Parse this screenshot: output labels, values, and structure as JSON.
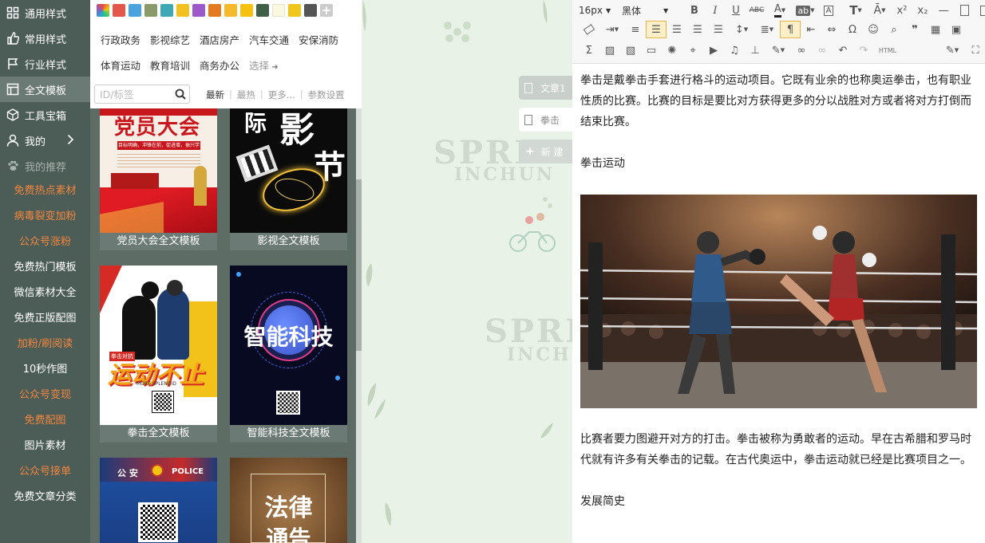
{
  "sidebar": {
    "items": [
      {
        "label": "通用样式",
        "icon": "grid-icon"
      },
      {
        "label": "常用样式",
        "icon": "thumbs-up-icon"
      },
      {
        "label": "行业样式",
        "icon": "flag-icon"
      },
      {
        "label": "全文模板",
        "icon": "template-icon"
      },
      {
        "label": "工具宝箱",
        "icon": "box-icon"
      },
      {
        "label": "我的",
        "icon": "user-icon"
      },
      {
        "label": "我的推荐",
        "icon": "paw-icon"
      }
    ],
    "promos": [
      {
        "label": "免费热点素材",
        "color": "orange"
      },
      {
        "label": "病毒裂变加粉",
        "color": "orange"
      },
      {
        "label": "公众号涨粉",
        "color": "orange"
      },
      {
        "label": "免费热门模板",
        "color": "white"
      },
      {
        "label": "微信素材大全",
        "color": "white"
      },
      {
        "label": "免费正版配图",
        "color": "white"
      },
      {
        "label": "加粉/刷阅读",
        "color": "orange"
      },
      {
        "label": "10秒作图",
        "color": "white"
      },
      {
        "label": "公众号变现",
        "color": "orange"
      },
      {
        "label": "免费配图",
        "color": "orange"
      },
      {
        "label": "图片素材",
        "color": "white"
      },
      {
        "label": "公众号接单",
        "color": "orange"
      },
      {
        "label": "免费文章分类",
        "color": "white"
      }
    ]
  },
  "filter": {
    "swatch_colors": [
      "#e4564a",
      "#4aa3df",
      "#8a9a6a",
      "#3fa8b4",
      "#f2c01f",
      "#9b59c9",
      "#e37a1f",
      "#f5b92b",
      "#f6c20f",
      "#3f5f47",
      "#fbf8e2",
      "#f0c61a",
      "#555555"
    ],
    "categories_row1": [
      "行政政务",
      "影视综艺",
      "酒店房产",
      "汽车交通",
      "安保消防"
    ],
    "categories_row2": [
      "体育运动",
      "教育培训",
      "商务办公"
    ],
    "select_label": "选择",
    "search_placeholder": "ID/标签",
    "sort_tabs": [
      "最新",
      "最热",
      "更多...",
      "参数设置"
    ]
  },
  "templates": [
    {
      "caption": "党员大会全文模板",
      "poster_title": "党员大会",
      "poster_sub": "目标明确，冲锋在前，促进增，振兴学"
    },
    {
      "caption": "影视全文模板",
      "poster_title": "影",
      "poster_title2": "节",
      "poster_side": "际"
    },
    {
      "caption": "拳击全文模板",
      "poster_title": "运动不止",
      "poster_tag": "拳击对抗",
      "poster_sub": "MORE SPLENDID"
    },
    {
      "caption": "智能科技全文模板",
      "poster_title": "智能科技"
    },
    {
      "caption": "",
      "poster_title": "公 安",
      "poster_sub": "POLICE"
    },
    {
      "caption": "",
      "poster_title": "法律",
      "poster_title2": "通告"
    }
  ],
  "middle": {
    "watermark1": "SPRING",
    "watermark1_sub": "INCHUN",
    "watermark2": "SPRIN",
    "watermark2_sub": "INCHUN",
    "tabs": [
      {
        "label": "文章1",
        "state": "dark"
      },
      {
        "label": "拳击",
        "state": "light"
      },
      {
        "label": "新 建",
        "state": "new"
      }
    ]
  },
  "toolbar": {
    "font_size": "16px",
    "font_family": "黑体",
    "html_label": "HTML"
  },
  "article": {
    "p1": "拳击是戴拳击手套进行格斗的运动项目。它既有业余的也称奥运拳击，也有职业性质的比赛。比赛的目标是要比对方获得更多的分以战胜对方或者将对方打倒而结束比赛。",
    "p2": "拳击运动",
    "p3": "比赛者要力图避开对方的打击。拳击被称为勇敢者的运动。早在古希腊和罗马时代就有许多有关拳击的记载。在古代奥运中，拳击运动就已经是比赛项目之一。",
    "p4": "发展简史"
  }
}
